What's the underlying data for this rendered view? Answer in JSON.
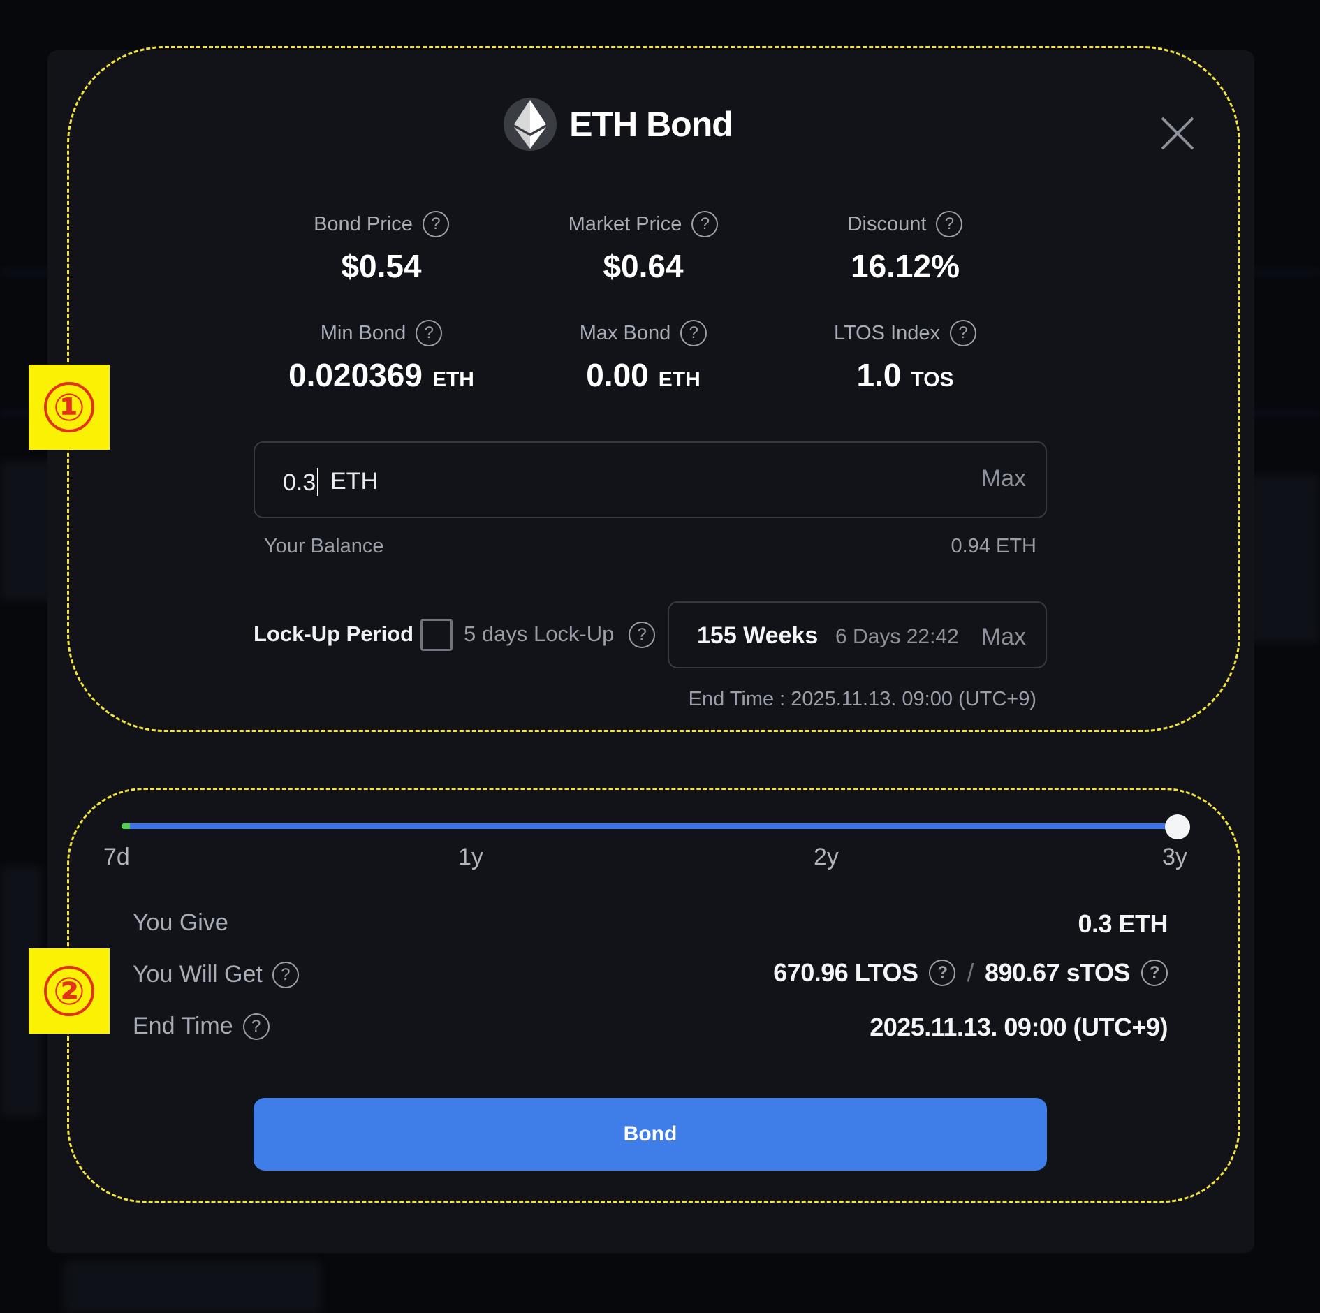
{
  "modal": {
    "title": "ETH Bond",
    "stats": {
      "bond_price": {
        "label": "Bond Price",
        "value": "$0.54"
      },
      "market_price": {
        "label": "Market Price",
        "value": "$0.64"
      },
      "discount": {
        "label": "Discount",
        "value": "16.12%"
      },
      "min_bond": {
        "label": "Min Bond",
        "value": "0.020369",
        "unit": "ETH"
      },
      "max_bond": {
        "label": "Max Bond",
        "value": "0.00",
        "unit": "ETH"
      },
      "ltos_index": {
        "label": "LTOS Index",
        "value": "1.0",
        "unit": "TOS"
      }
    },
    "amount_input": {
      "value": "0.3",
      "unit": "ETH",
      "max_label": "Max"
    },
    "balance": {
      "label": "Your Balance",
      "value": "0.94 ETH"
    },
    "lockup": {
      "label": "Lock-Up Period",
      "option_label": "5 days Lock-Up",
      "checked": false,
      "weeks": "155 Weeks",
      "remainder": "6 Days 22:42",
      "max_label": "Max",
      "end_time": "End Time : 2025.11.13. 09:00 (UTC+9)"
    },
    "slider": {
      "ticks": [
        "7d",
        "1y",
        "2y",
        "3y"
      ],
      "value_fraction": 1.0
    },
    "summary": {
      "you_give": {
        "label": "You Give",
        "value": "0.3 ETH"
      },
      "you_will_get": {
        "label": "You Will Get",
        "ltos": "670.96 LTOS",
        "separator": "/",
        "stos": "890.67 sTOS"
      },
      "end_time": {
        "label": "End Time",
        "value": "2025.11.13. 09:00 (UTC+9)"
      }
    },
    "bond_button": "Bond"
  },
  "annotations": [
    "①",
    "②"
  ],
  "colors": {
    "accent": "#3f7ee9",
    "annotation_border": "#f3e33b",
    "annotation_bg": "#fbf104",
    "annotation_number": "#e5301c",
    "modal_bg": "#111318",
    "slider_start": "#4fcf4a"
  },
  "icons": [
    "ethereum-icon",
    "close-icon",
    "help-icon"
  ]
}
